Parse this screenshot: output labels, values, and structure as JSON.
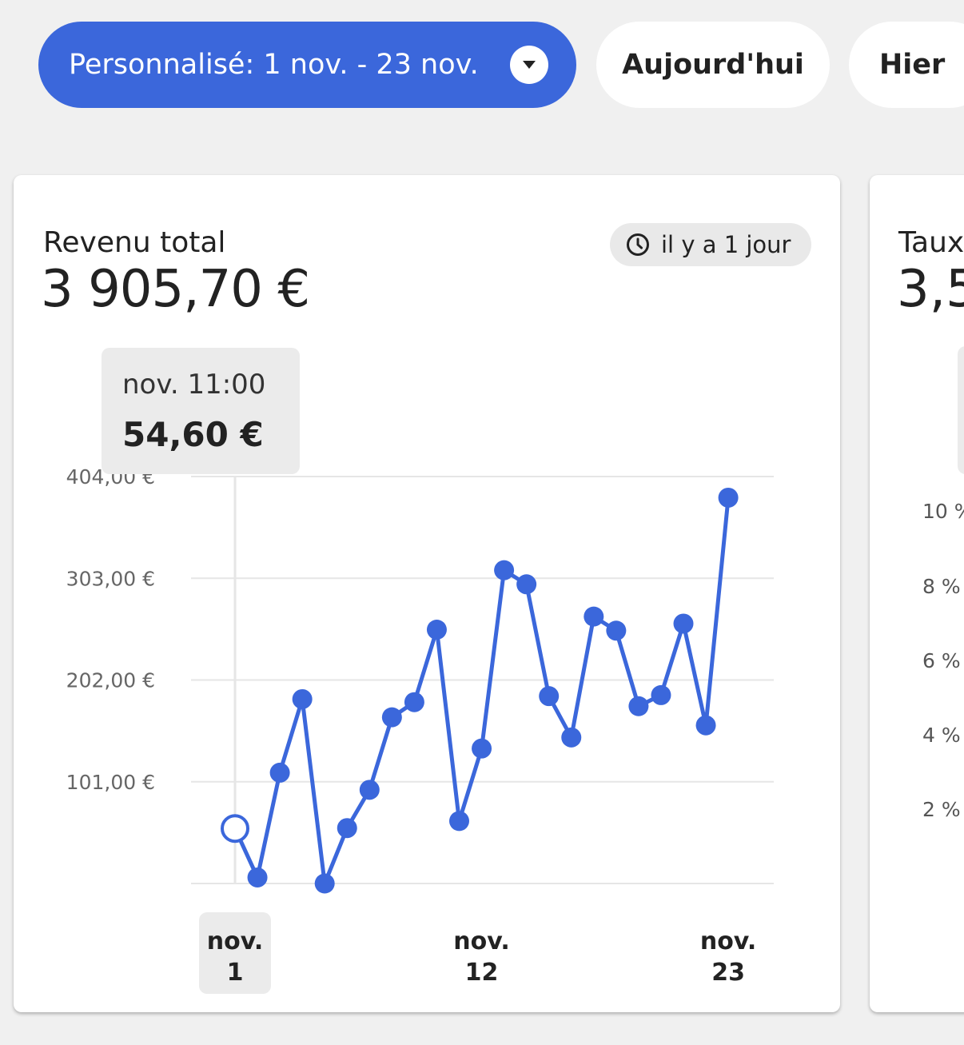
{
  "filters": {
    "custom_range_label": "Personnalisé: 1 nov. - 23 nov.",
    "today_label": "Aujourd'hui",
    "yesterday_label": "Hier"
  },
  "revenue_card": {
    "title": "Revenu total",
    "value": "3 905,70 €",
    "updated_label": "il y a 1 jour",
    "tooltip": {
      "label": "nov. 11:00",
      "value": "54,60 €"
    }
  },
  "side_card": {
    "title": "Taux",
    "value": "3,5",
    "y_ticks": [
      "10 %",
      "8 %",
      "6 %",
      "4 %",
      "2 %"
    ]
  },
  "colors": {
    "accent": "#3b67db",
    "grid": "#e6e6e6",
    "chip": "#ebebeb"
  },
  "chart_data": {
    "type": "line",
    "title": "Revenu total",
    "x": [
      "nov. 1",
      "nov. 2",
      "nov. 3",
      "nov. 4",
      "nov. 5",
      "nov. 6",
      "nov. 7",
      "nov. 8",
      "nov. 9",
      "nov. 10",
      "nov. 11",
      "nov. 12",
      "nov. 13",
      "nov. 14",
      "nov. 15",
      "nov. 16",
      "nov. 17",
      "nov. 18",
      "nov. 19",
      "nov. 20",
      "nov. 21",
      "nov. 22",
      "nov. 23"
    ],
    "series": [
      {
        "values": [
          54.6,
          6,
          110,
          183,
          0,
          55,
          93,
          165,
          180,
          252,
          62,
          134,
          311,
          297,
          186,
          145,
          265,
          251,
          176,
          187,
          258,
          157,
          383
        ]
      }
    ],
    "ylim": [
      0,
      404
    ],
    "y_ticks": [
      101,
      202,
      303,
      404
    ],
    "y_tick_labels": [
      "101,00 €",
      "202,00 €",
      "303,00 €",
      "404,00 €"
    ],
    "x_tick_labels": [
      {
        "month": "nov.",
        "day": "1"
      },
      {
        "month": "nov.",
        "day": "12"
      },
      {
        "month": "nov.",
        "day": "23"
      }
    ],
    "highlighted_index": 0,
    "grid": true
  }
}
